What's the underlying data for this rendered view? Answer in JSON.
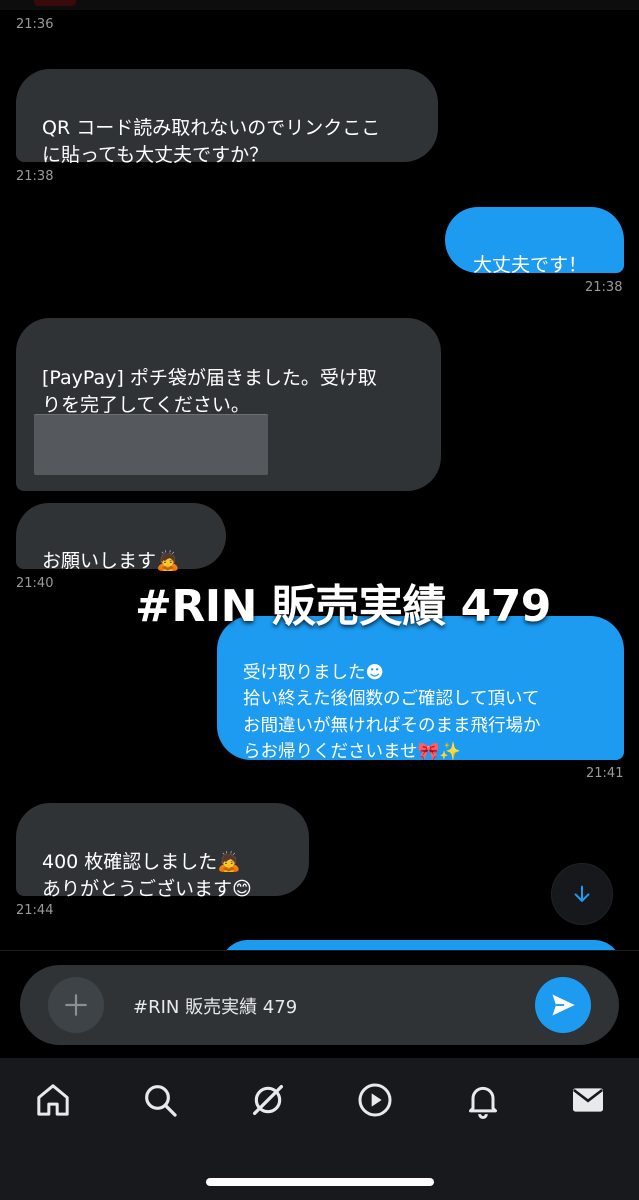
{
  "messages": [
    {
      "id": "m0",
      "timestamp": "21:36"
    },
    {
      "id": "m1",
      "direction": "received",
      "text": "QR コード読み取れないのでリンクここ\nに貼っても大丈夫ですか？",
      "timestamp": "21:38"
    },
    {
      "id": "m2",
      "direction": "sent",
      "text": "大丈夫です！",
      "timestamp": "21:38"
    },
    {
      "id": "m3",
      "direction": "received",
      "text": "[PayPay] ポチ袋が届きました。受け取\nりを完了してください。"
    },
    {
      "id": "m4",
      "direction": "received",
      "text": "お願いします🙇",
      "timestamp": "21:40"
    },
    {
      "id": "m5",
      "direction": "sent",
      "text": "受け取りました☻\n拾い終えた後個数のご確認して頂いて\nお間違いが無ければそのまま飛行場か\nらお帰りくださいませ🎀✨",
      "timestamp": "21:41"
    },
    {
      "id": "m6",
      "direction": "received",
      "text": "400 枚確認しました🙇\nありがとうございます😊",
      "timestamp": "21:44"
    }
  ],
  "overlay": {
    "title": "#RIN 販売実績 479"
  },
  "composer": {
    "value": "#RIN 販売実績 479"
  },
  "icons": {
    "plus": "plus-icon",
    "send": "send-icon",
    "scroll_down": "arrow-down-icon",
    "home": "home-icon",
    "search": "search-icon",
    "grok": "grok-icon",
    "video": "play-icon",
    "notifications": "bell-icon",
    "messages": "mail-icon"
  },
  "colors": {
    "accent": "#1d9bf0",
    "received_bubble": "#2f3336",
    "background": "#000000"
  }
}
